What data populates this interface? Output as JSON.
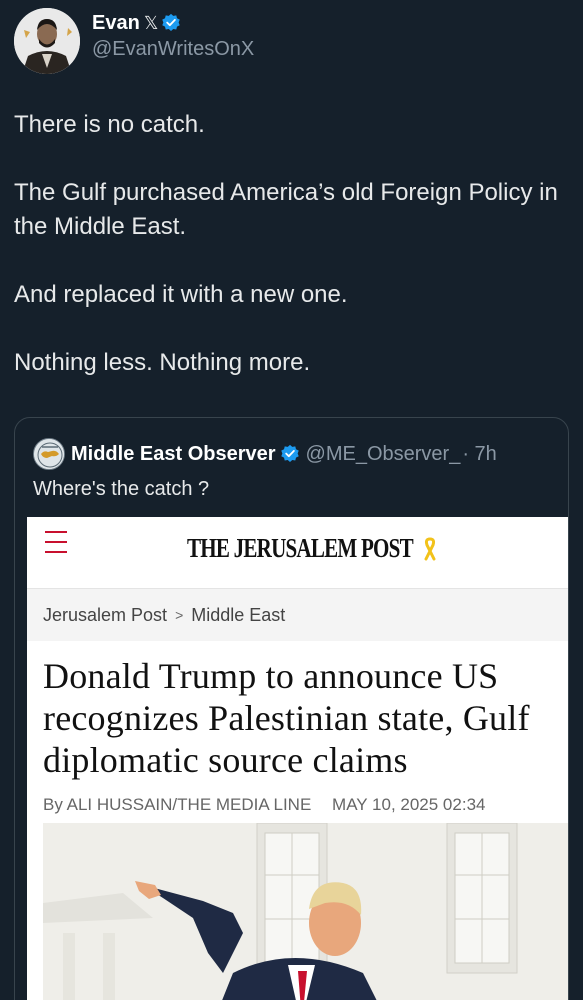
{
  "author": {
    "name": "Evan",
    "x_mark": "𝕏",
    "handle": "@EvanWritesOnX"
  },
  "tweet": {
    "paragraphs": [
      "There is no catch.",
      "The Gulf purchased America’s old Foreign Policy in the Middle East.",
      "And replaced it with a new one.",
      "Nothing less. Nothing more."
    ]
  },
  "quote": {
    "name": "Middle East Observer",
    "handle": "@ME_Observer_",
    "time": "· 7h",
    "text": "Where's the catch ?",
    "article": {
      "site": "THE JERUSALEM POST",
      "breadcrumb": [
        "Jerusalem Post",
        "Middle East"
      ],
      "breadcrumb_sep": ">",
      "headline": "Donald Trump to announce US recognizes Palestinian state, Gulf diplomatic source claims",
      "byline_author": "By ALI HUSSAIN/THE MEDIA LINE",
      "byline_date": "MAY 10, 2025 02:34"
    }
  },
  "colors": {
    "background": "#15202b",
    "verified_blue": "#1d9bf0",
    "jpost_red": "#c8102e"
  },
  "icons": [
    "user-avatar",
    "x-logo-icon",
    "verified-badge-icon",
    "hamburger-menu-icon",
    "yellow-ribbon-icon"
  ]
}
